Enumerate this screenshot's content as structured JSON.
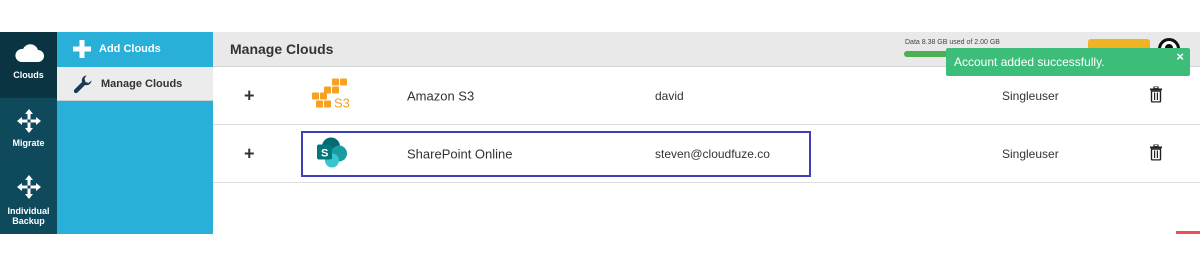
{
  "nav": {
    "items": [
      {
        "label": "Clouds",
        "icon": "cloud-icon"
      },
      {
        "label": "Migrate",
        "icon": "move-arrows-icon"
      },
      {
        "label": "Individual Backup",
        "icon": "move-arrows-icon"
      }
    ]
  },
  "subnav": {
    "add_label": "Add Clouds",
    "manage_label": "Manage Clouds"
  },
  "header": {
    "title": "Manage Clouds",
    "usage_text": "Data 8.38 GB used of 2.00 GB",
    "usage_fraction": 0.85
  },
  "toast": {
    "message": "Account added successfully.",
    "close": "×"
  },
  "clouds": [
    {
      "expand": "+",
      "logo": "amazon-s3-logo",
      "name": "Amazon S3",
      "user": "david",
      "type": "Singleuser",
      "action_icon": "trash-icon"
    },
    {
      "expand": "+",
      "logo": "sharepoint-logo",
      "name": "SharePoint Online",
      "user": "steven@cloudfuze.co",
      "type": "Singleuser",
      "action_icon": "trash-icon"
    }
  ],
  "colors": {
    "nav_dark": "#0e4a5c",
    "subnav_blue": "#29b0d9",
    "toast_green": "#3dbd7a",
    "highlight_border": "#3f3fb7",
    "orange_button": "#f0b323"
  }
}
